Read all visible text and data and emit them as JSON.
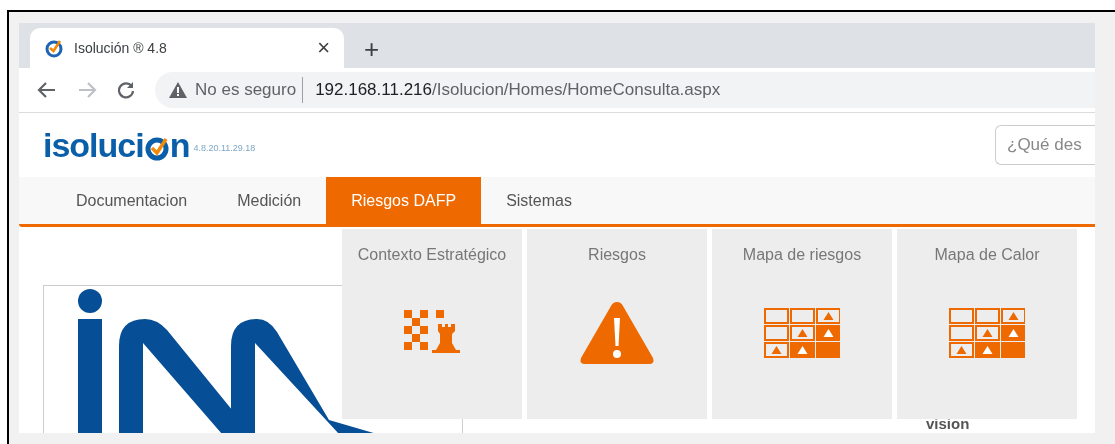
{
  "browser": {
    "tab": {
      "title": "Isolución ® 4.8",
      "close": "×"
    },
    "new_tab": "+",
    "security": "No es seguro",
    "url_host": "192.168.11.216",
    "url_path": "/Isolucion/Homes/HomeConsulta.aspx"
  },
  "header": {
    "logo_before": "isoluci",
    "logo_after": "n",
    "version": "4.8.20.11.29.18",
    "search": {
      "placeholder": "¿Qué des"
    }
  },
  "nav": [
    {
      "label": "Documentacion",
      "selected": false
    },
    {
      "label": "Medición",
      "selected": false
    },
    {
      "label": "Riesgos DAFP",
      "selected": true
    },
    {
      "label": "Sistemas",
      "selected": false
    }
  ],
  "dropdown": [
    {
      "label": "Contexto Estratégico",
      "kind": "chess"
    },
    {
      "label": "Riesgos",
      "kind": "warning"
    },
    {
      "label": "Mapa de riesgos",
      "kind": "heatmap"
    },
    {
      "label": "Mapa de Calor",
      "kind": "heatmap"
    }
  ],
  "content": {
    "caption": "vision"
  }
}
